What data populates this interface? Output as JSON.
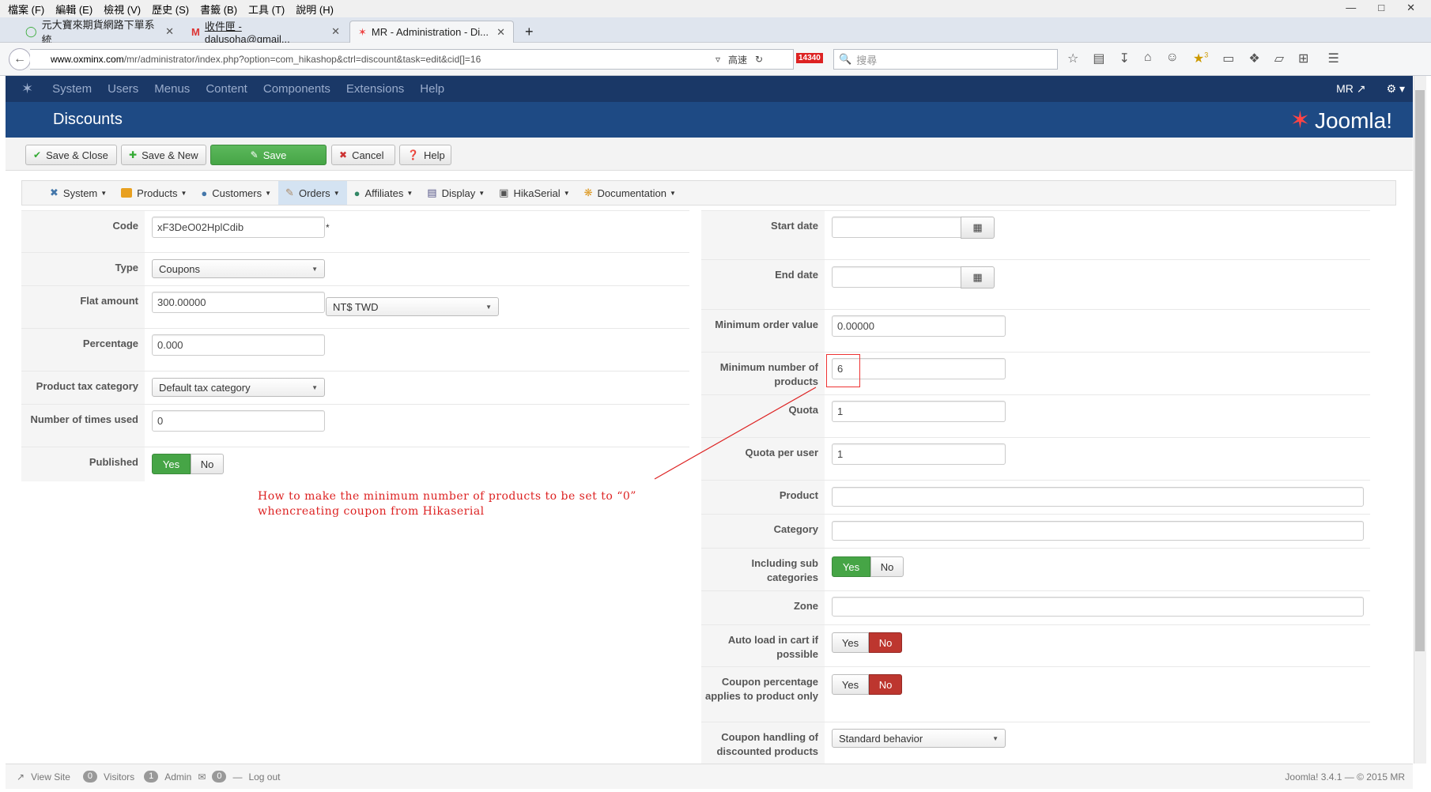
{
  "browser": {
    "menu": [
      "檔案 (F)",
      "編輯 (E)",
      "檢視 (V)",
      "歷史 (S)",
      "書籤 (B)",
      "工具 (T)",
      "說明 (H)"
    ],
    "tabs": [
      {
        "title": "元大寶來期貨網路下單系統"
      },
      {
        "title": "收件匣 - dalusoha@gmail..."
      },
      {
        "title": "MR - Administration - Di..."
      }
    ],
    "new_tab": "+",
    "url_domain": "www.oxminx.com",
    "url_path": "/mr/administrator/index.php?option=com_hikashop&ctrl=discount&task=edit&cid[]=16",
    "url_extra": "高速",
    "badge": "14340",
    "search_placeholder": "搜尋",
    "notify_count": "3"
  },
  "joomla": {
    "nav": [
      "System",
      "Users",
      "Menus",
      "Content",
      "Components",
      "Extensions",
      "Help"
    ],
    "user": "MR",
    "page_title": "Discounts",
    "brand": "Joomla!",
    "toolbar": {
      "save_close": "Save & Close",
      "save_new": "Save & New",
      "save": "Save",
      "cancel": "Cancel",
      "help": "Help"
    },
    "hika_menu": [
      "System",
      "Products",
      "Customers",
      "Orders",
      "Affiliates",
      "Display",
      "HikaSerial",
      "Documentation"
    ]
  },
  "form_left": {
    "code_label": "Code",
    "code_value": "xF3DeO02HplCdib",
    "code_required": "*",
    "type_label": "Type",
    "type_value": "Coupons",
    "flat_label": "Flat amount",
    "flat_value": "300.00000",
    "currency_value": "NT$ TWD",
    "percentage_label": "Percentage",
    "percentage_value": "0.000",
    "taxcat_label": "Product tax category",
    "taxcat_value": "Default tax category",
    "times_label": "Number of times used",
    "times_value": "0",
    "published_label": "Published",
    "yes": "Yes",
    "no": "No"
  },
  "form_right": {
    "start_label": "Start date",
    "end_label": "End date",
    "min_order_label": "Minimum order value",
    "min_order_value": "0.00000",
    "min_products_label": "Minimum number of products",
    "min_products_value": "6",
    "quota_label": "Quota",
    "quota_value": "1",
    "quota_user_label": "Quota per user",
    "quota_user_value": "1",
    "product_label": "Product",
    "category_label": "Category",
    "subcat_label": "Including sub categories",
    "zone_label": "Zone",
    "autoload_label": "Auto load in cart if possible",
    "coupon_pct_label": "Coupon percentage applies to product only",
    "coupon_handling_label": "Coupon handling of discounted products",
    "coupon_handling_value": "Standard behavior",
    "yes": "Yes",
    "no": "No"
  },
  "annotation": {
    "line1": "How to make the minimum number of products to be set to  “0”",
    "line2": "whencreating coupon from Hikaserial",
    "color": "#dd2222"
  },
  "footer": {
    "view_site": "View Site",
    "visitors_count": "0",
    "visitors": "Visitors",
    "admin_count": "1",
    "admin": "Admin",
    "msg_count": "0",
    "logout": "Log out",
    "version": "Joomla! 3.4.1 — © 2015 MR"
  }
}
